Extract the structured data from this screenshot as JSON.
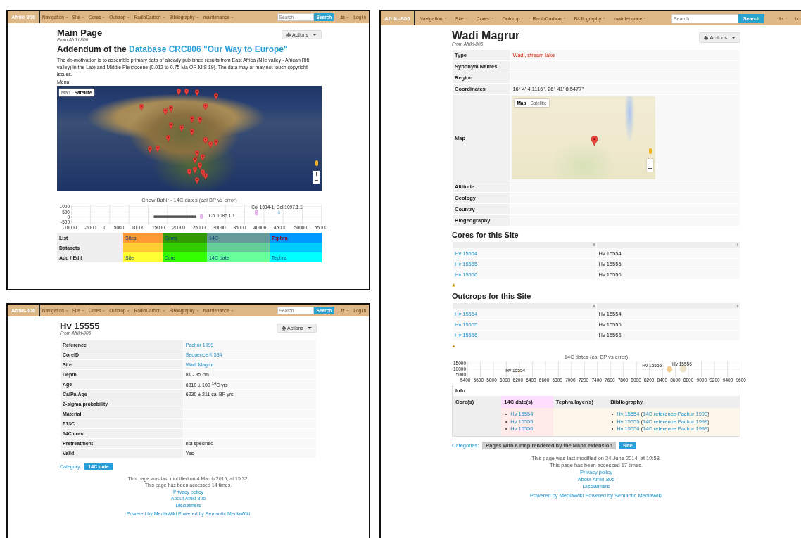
{
  "panels": [
    {
      "navbar": {
        "brand": "Afriki-806",
        "items": [
          "Navigation",
          "Site",
          "Cores",
          "Outcrop",
          "RadioCarbon",
          "Bibliography",
          "maintenance"
        ],
        "search_placeholder": "Search",
        "search_button": "Search",
        "login": "Log in"
      },
      "title": "Main Page",
      "from": "From Afriki-806",
      "actions": "Actions",
      "blocks": [
        {
          "kind": "heading",
          "text": "Addendum of the ",
          "link": "Database CRC806 \"Our Way to Europe\""
        },
        {
          "kind": "paragraph",
          "text": "The db-motivation is to assemble primary data of already published results from East Africa (Nile valley - African Rift valley) in the Late and Middle Pleistocene (0.012 to 0.75 Ma OR MIS 19). The data may or may not touch copyright issues."
        },
        {
          "kind": "label",
          "text": "Menu"
        },
        {
          "kind": "satellite_map",
          "buttons": [
            {
              "label": "Map",
              "selected": false
            },
            {
              "label": "Satellite",
              "selected": true
            }
          ]
        },
        {
          "kind": "chart",
          "title": "Chew Bahir - 14C dates (cal BP vs error)",
          "yticks": [
            "1000",
            "500",
            "0",
            "-500"
          ],
          "xticks": [
            "-10000",
            "-5000",
            "0",
            "5000",
            "10000",
            "15000",
            "20000",
            "25000",
            "30000",
            "35000",
            "40000",
            "45000",
            "50000",
            "55000"
          ],
          "labels": [
            "Col 1085.1.1",
            "Col 1094-1, Col 1097.1.1"
          ]
        },
        {
          "kind": "color_grid",
          "rows": [
            {
              "label": "List",
              "cells": [
                {
                  "text": "Sites",
                  "kind": "link",
                  "color": "#ff9933"
                },
                {
                  "text": "Cores",
                  "kind": "link",
                  "color": "#339900"
                },
                {
                  "text": "14C",
                  "kind": "link",
                  "color": "#669999"
                },
                {
                  "text": "Tephra",
                  "kind": "redlink",
                  "color": "#0099ff"
                }
              ]
            },
            {
              "label": "Datasets",
              "cells": [
                {
                  "color": "#ffcc33"
                },
                {
                  "color": "#33cc00"
                },
                {
                  "color": "#66cc99"
                },
                {
                  "color": "#00ccff"
                }
              ]
            },
            {
              "label": "Add / Edit",
              "cells": [
                {
                  "text": "Site",
                  "kind": "link",
                  "color": "#ffff33"
                },
                {
                  "text": "Core",
                  "kind": "link",
                  "color": "#33ff00"
                },
                {
                  "text": "14C date",
                  "kind": "link",
                  "color": "#66ff99"
                },
                {
                  "text": "Tephra",
                  "kind": "link",
                  "color": "#00ffff"
                }
              ]
            }
          ]
        }
      ]
    },
    {
      "navbar": {
        "brand": "Afriki-806",
        "items": [
          "Navigation",
          "Site",
          "Cores",
          "Outcrop",
          "RadioCarbon",
          "Bibliography",
          "maintenance"
        ],
        "search_placeholder": "Search",
        "search_button": "Search",
        "login": "Log in"
      },
      "title": "Hv 15555",
      "from": "From Afriki-806",
      "actions": "Actions",
      "blocks": [
        {
          "kind": "fact_table",
          "rows": [
            {
              "label": "Reference",
              "value": "Pachur 1999",
              "kind": "link"
            },
            {
              "label": "CoreID",
              "value": "Sequence K 534",
              "kind": "link"
            },
            {
              "label": "Site",
              "value": "Wadi Magrur",
              "kind": "link"
            },
            {
              "label": "Depth",
              "value": "81 - 85 cm",
              "kind": "text"
            },
            {
              "label": "Age",
              "value": "6310 ± 100 $^{14}$C yrs",
              "kind": "text"
            },
            {
              "label": "CalPalAge",
              "value": "6230 ± 211 cal BP yrs",
              "kind": "text"
            },
            {
              "label": "2-sigma probability"
            },
            {
              "label": "Material"
            },
            {
              "label": "δ13C"
            },
            {
              "label": "14C conc."
            },
            {
              "label": "Pretreatment",
              "value": "not specified",
              "kind": "text"
            },
            {
              "label": "Valid",
              "value": "Yes",
              "kind": "text"
            }
          ]
        },
        {
          "kind": "categories",
          "label": "Category:",
          "tags": [
            {
              "text": "14C date",
              "color": "#2a9fd6"
            }
          ]
        },
        {
          "kind": "footer",
          "lines": [
            "This page was last modified on 4 March 2015, at 15:32.",
            "This page has been accessed 14 times."
          ],
          "links": [
            "Privacy policy",
            "About Afriki-806",
            "Disclaimers"
          ],
          "powered": "Powered by MediaWiki Powered by Semantic MediaWiki"
        }
      ]
    },
    {
      "navbar": {
        "brand": "Afriki-806",
        "items": [
          "Navigation",
          "Site",
          "Cores",
          "Outcrop",
          "RadioCarbon",
          "Bibliography",
          "maintenance"
        ],
        "search_placeholder": "Search",
        "search_button": "Search",
        "login": "Lo"
      },
      "title": "Wadi Magrur",
      "from": "From Afriki-806",
      "actions": "Actions",
      "blocks": [
        {
          "kind": "fact_table",
          "rows": [
            {
              "label": "Type",
              "value": "Wadi, stream lake",
              "kind": "redlink"
            },
            {
              "label": "Synonym Names"
            },
            {
              "label": "Region"
            },
            {
              "label": "Coordinates",
              "value": "16° 4' 4.1116\", 26° 41' 8.5477\"",
              "kind": "text"
            },
            {
              "label": "Map",
              "kind": "map",
              "buttons": [
                {
                  "label": "Map",
                  "selected": true
                },
                {
                  "label": "Satellite",
                  "selected": false
                }
              ]
            },
            {
              "label": "Altitude"
            },
            {
              "label": "Geology"
            },
            {
              "label": "Country"
            },
            {
              "label": "Biogeography"
            }
          ]
        },
        {
          "kind": "section_heading",
          "text": "Cores for this Site"
        },
        {
          "kind": "link_table",
          "rows": [
            {
              "link": "Hv 15554",
              "text": "Hv 15554"
            },
            {
              "link": "Hv 15555",
              "text": "Hv 15555"
            },
            {
              "link": "Hv 15556",
              "text": "Hv 15556"
            }
          ]
        },
        {
          "kind": "warning"
        },
        {
          "kind": "section_heading",
          "text": "Outcrops for this Site"
        },
        {
          "kind": "link_table",
          "rows": [
            {
              "link": "Hv 15554",
              "text": "Hv 15554"
            },
            {
              "link": "Hv 15555",
              "text": "Hv 15555"
            },
            {
              "link": "Hv 15556",
              "text": "Hv 15556"
            }
          ]
        },
        {
          "kind": "warning"
        },
        {
          "kind": "chart",
          "title": "14C dates (cal BP vs error)",
          "yticks": [
            "15000",
            "10000",
            "5000"
          ],
          "xticks": [
            "5400",
            "5600",
            "5800",
            "6000",
            "6200",
            "6400",
            "6600",
            "6800",
            "7000",
            "7200",
            "7400",
            "7600",
            "7800",
            "8000",
            "8200",
            "8400",
            "8600",
            "8800",
            "9000",
            "9200",
            "9400",
            "9600"
          ],
          "labels": [
            "Hv 15554",
            "Hv 15555",
            "Hv 15556"
          ]
        },
        {
          "kind": "info_box",
          "tab": "Info",
          "headers": [
            "Core(s)",
            "14C date(s)",
            "Tephra layer(s)",
            "Bibliography"
          ],
          "dates": [
            "Hv 15554",
            "Hv 15555",
            "Hv 15556"
          ],
          "bibliography": [
            {
              "core": "Hv 15554",
              "open": " (",
              "ref": "14C reference Pachur 1999",
              "close": ")"
            },
            {
              "core": "Hv 15555",
              "open": " (",
              "ref": "14C reference Pachur 1999",
              "close": ")"
            },
            {
              "core": "Hv 15556",
              "open": " (",
              "ref": "14C reference Pachur 1999",
              "close": ")"
            }
          ]
        },
        {
          "kind": "categories",
          "label": "Categories:",
          "tags": [
            {
              "text": "Pages with a map rendered by the Maps extension",
              "color": "#cccccc"
            },
            {
              "text": "Site",
              "color": "#2a9fd6"
            }
          ]
        },
        {
          "kind": "footer",
          "lines": [
            "This page was last modified on 24 June 2014, at 10:58.",
            "This page has been accessed 17 times."
          ],
          "links": [
            "Privacy policy",
            "About Afriki-806",
            "Disclaimers"
          ],
          "powered": "Powered by MediaWiki Powered by Semantic MediaWiki"
        }
      ]
    }
  ]
}
